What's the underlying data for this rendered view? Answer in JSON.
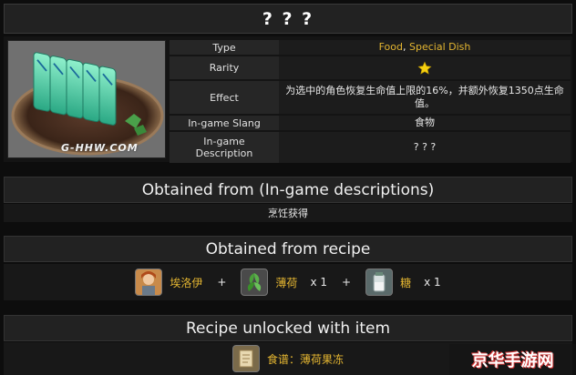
{
  "title": "? ? ?",
  "watermark": "G-HHW.COM",
  "properties": {
    "type_label": "Type",
    "type_value_1": "Food",
    "type_sep": ", ",
    "type_value_2": "Special Dish",
    "rarity_label": "Rarity",
    "rarity_stars": 1,
    "effect_label": "Effect",
    "effect_value": "为选中的角色恢复生命值上限的16%，并额外恢复1350点生命值。",
    "slang_label": "In-game Slang",
    "slang_value": "食物",
    "desc_label_1": "In-game",
    "desc_label_2": "Description",
    "desc_value": "? ? ?"
  },
  "obtained": {
    "title": "Obtained from (In-game descriptions)",
    "value": "烹饪获得"
  },
  "recipe": {
    "title": "Obtained from recipe",
    "plus": "+",
    "items": [
      {
        "name": "埃洛伊",
        "qty": ""
      },
      {
        "name": "薄荷",
        "qty": "x 1"
      },
      {
        "name": "糖",
        "qty": "x 1"
      }
    ]
  },
  "unlock": {
    "title": "Recipe unlocked with item",
    "item": "食谱：薄荷果冻"
  },
  "brand": "京华手游网",
  "colors": {
    "accent_gold": "#e3b531",
    "jelly": "#3fd6a6"
  }
}
